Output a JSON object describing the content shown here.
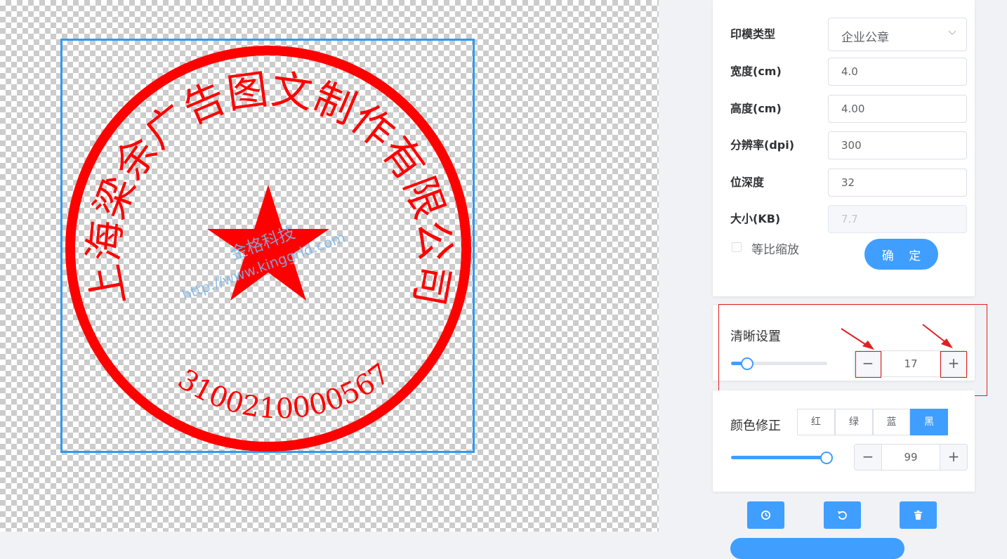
{
  "seal": {
    "company_text": "上海梁余广告图文制作有限公司",
    "code_text": "3100210000567",
    "watermark_cn": "金格科技",
    "watermark_url": "http://www.kinggrid.com",
    "color": "#ff0000"
  },
  "params": {
    "type_label": "印模类型",
    "type_value": "企业公章",
    "width_label": "宽度(cm)",
    "width_value": "4.0",
    "height_label": "高度(cm)",
    "height_value": "4.00",
    "dpi_label": "分辨率(dpi)",
    "dpi_value": "300",
    "depth_label": "位深度",
    "depth_value": "32",
    "size_label": "大小(KB)",
    "size_value": "7.7",
    "keep_ratio_label": "等比缩放",
    "keep_ratio_checked": false,
    "confirm_label": "确 定"
  },
  "clarity": {
    "title": "清晰设置",
    "value": "17",
    "slider_fraction": 0.17,
    "minus_label": "−",
    "plus_label": "+"
  },
  "color": {
    "title": "颜色修正",
    "options": [
      "红",
      "绿",
      "蓝",
      "黑"
    ],
    "active_index": 3,
    "value": "99",
    "slider_fraction": 0.99,
    "minus_label": "−",
    "plus_label": "+"
  },
  "toolbar": {
    "icons": [
      "clock-icon",
      "undo-icon",
      "trash-icon"
    ]
  },
  "theme": {
    "accent": "#409eff",
    "annotation": "#e02020"
  }
}
